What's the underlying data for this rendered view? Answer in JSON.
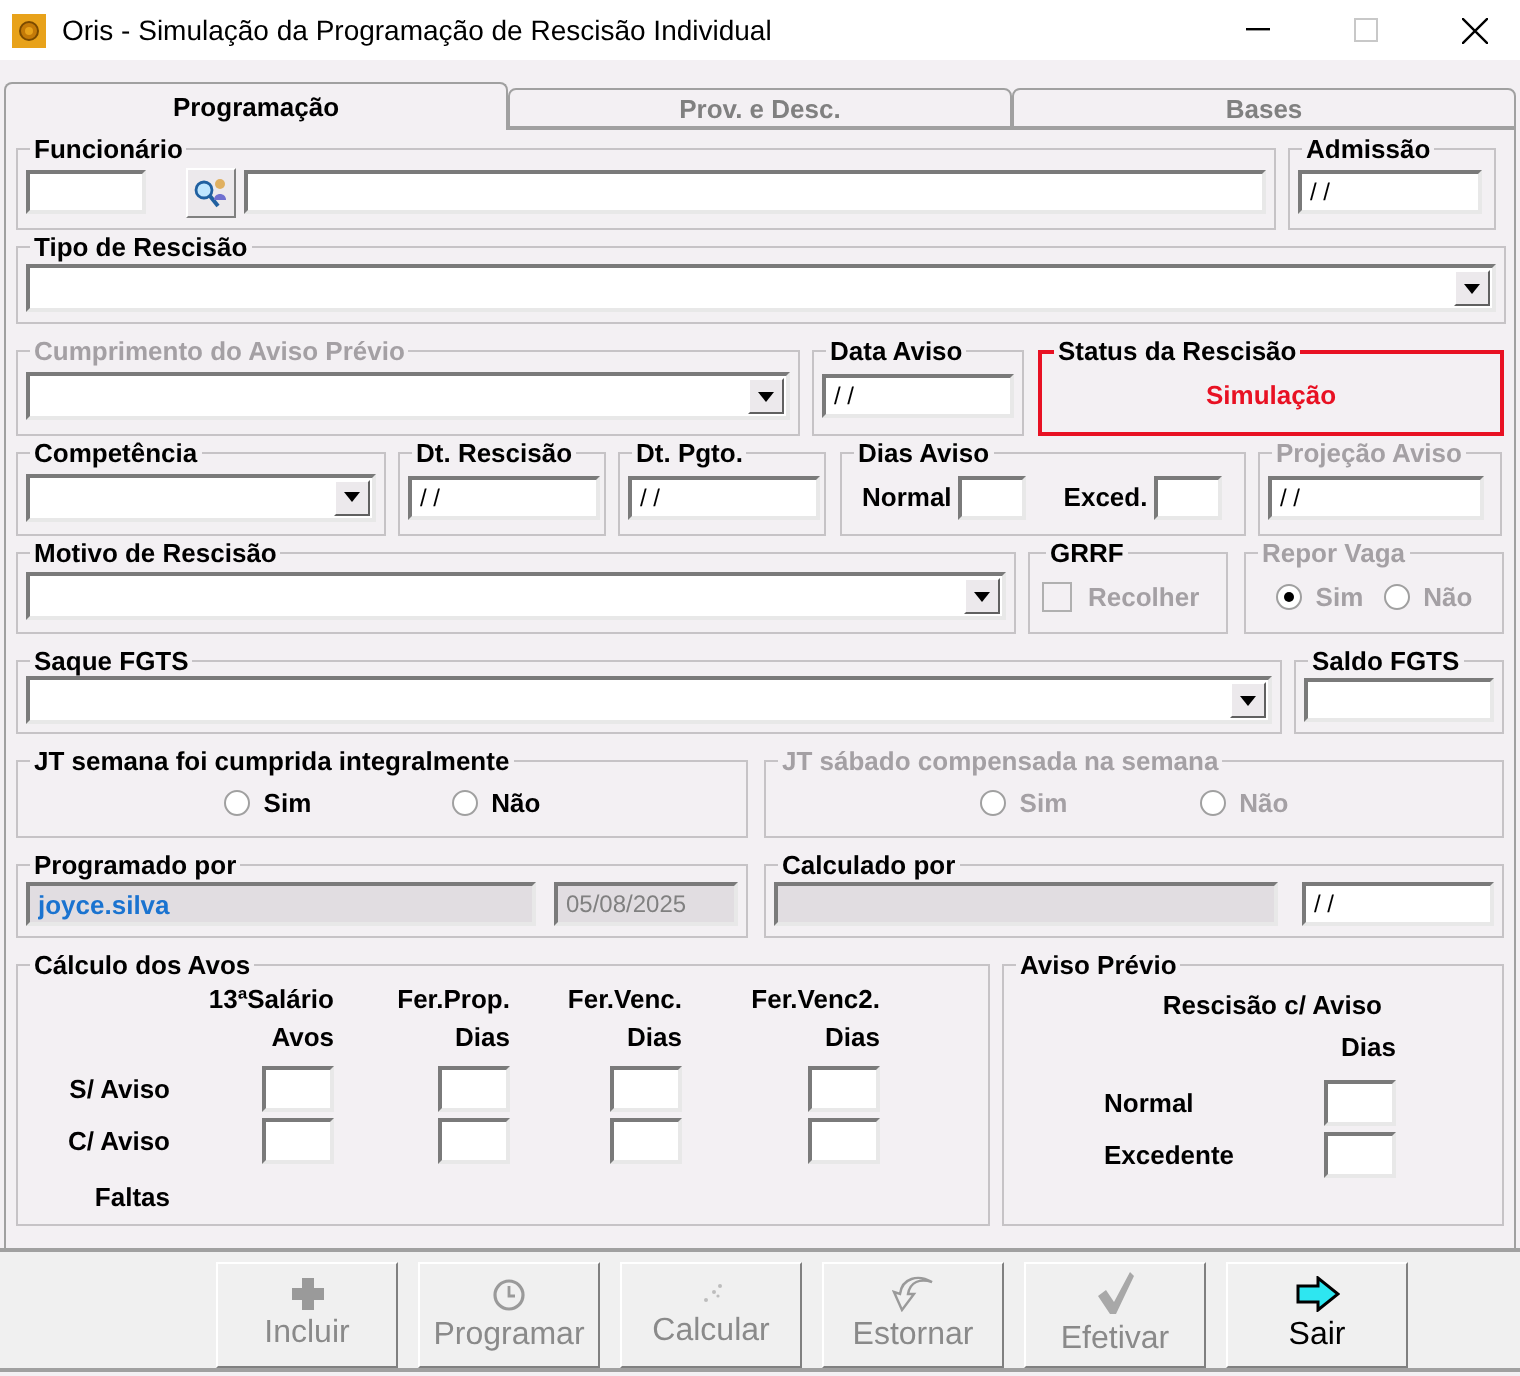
{
  "window": {
    "title": "Oris - Simulação da Programação de Rescisão Individual"
  },
  "tabs": [
    {
      "label": "Programação",
      "selected": true
    },
    {
      "label": "Prov. e Desc.",
      "selected": false
    },
    {
      "label": "Bases",
      "selected": false
    }
  ],
  "funcionario": {
    "label": "Funcionário"
  },
  "admissao": {
    "label": "Admissão",
    "value": "/ /"
  },
  "tipo_rescisao": {
    "label": "Tipo de Rescisão"
  },
  "cumprimento_aviso": {
    "label": "Cumprimento do Aviso Prévio",
    "disabled": true
  },
  "data_aviso": {
    "label": "Data Aviso",
    "value": "/ /"
  },
  "status_rescisao": {
    "label": "Status da Rescisão",
    "value": "Simulação"
  },
  "competencia": {
    "label": "Competência"
  },
  "dt_rescisao": {
    "label": "Dt. Rescisão",
    "value": "/ /"
  },
  "dt_pgto": {
    "label": "Dt. Pgto.",
    "value": "/ /"
  },
  "dias_aviso": {
    "label": "Dias Aviso",
    "fields": [
      {
        "label": "Normal"
      },
      {
        "label": "Exced."
      }
    ]
  },
  "projecao_aviso": {
    "label": "Projeção Aviso",
    "value": "/ /",
    "disabled": true
  },
  "motivo_rescisao": {
    "label": "Motivo de Rescisão"
  },
  "grrf": {
    "label": "GRRF",
    "option": "Recolher",
    "checked": false,
    "disabled": true
  },
  "repor_vaga": {
    "label": "Repor Vaga",
    "disabled": true,
    "options": [
      {
        "label": "Sim",
        "selected": true
      },
      {
        "label": "Não",
        "selected": false
      }
    ]
  },
  "saque_fgts": {
    "label": "Saque FGTS"
  },
  "saldo_fgts": {
    "label": "Saldo FGTS"
  },
  "jt_semana": {
    "label": "JT semana foi cumprida integralmente",
    "disabled": false,
    "options": [
      {
        "label": "Sim",
        "selected": false
      },
      {
        "label": "Não",
        "selected": false
      }
    ]
  },
  "jt_sabado": {
    "label": "JT sábado compensada na semana",
    "disabled": true,
    "options": [
      {
        "label": "Sim",
        "selected": false
      },
      {
        "label": "Não",
        "selected": false
      }
    ]
  },
  "programado_por": {
    "label": "Programado por",
    "user": "joyce.silva",
    "date": "05/08/2025"
  },
  "calculado_por": {
    "label": "Calculado por",
    "date": "/ /"
  },
  "calculo_avos": {
    "label": "Cálculo dos Avos",
    "columns": [
      {
        "title": "13ªSalário",
        "unit": "Avos"
      },
      {
        "title": "Fer.Prop.",
        "unit": "Dias"
      },
      {
        "title": "Fer.Venc.",
        "unit": "Dias"
      },
      {
        "title": "Fer.Venc2.",
        "unit": "Dias"
      }
    ],
    "rows": [
      {
        "label": "S/ Aviso",
        "kind": "input"
      },
      {
        "label": "C/ Aviso",
        "kind": "input"
      },
      {
        "label": "Faltas",
        "kind": "label"
      }
    ]
  },
  "aviso_previo": {
    "label": "Aviso Prévio",
    "heading": "Rescisão c/ Aviso",
    "unit": "Dias",
    "rows": [
      {
        "label": "Normal"
      },
      {
        "label": "Excedente"
      }
    ]
  },
  "buttons": [
    {
      "label": "Incluir",
      "kind": "add",
      "disabled": true
    },
    {
      "label": "Programar",
      "kind": "clock",
      "disabled": true
    },
    {
      "label": "Calcular",
      "kind": "calc",
      "disabled": true
    },
    {
      "label": "Estornar",
      "kind": "undo",
      "disabled": true
    },
    {
      "label": "Efetivar",
      "kind": "check",
      "disabled": true
    },
    {
      "label": "Sair",
      "kind": "exit",
      "disabled": false
    }
  ]
}
